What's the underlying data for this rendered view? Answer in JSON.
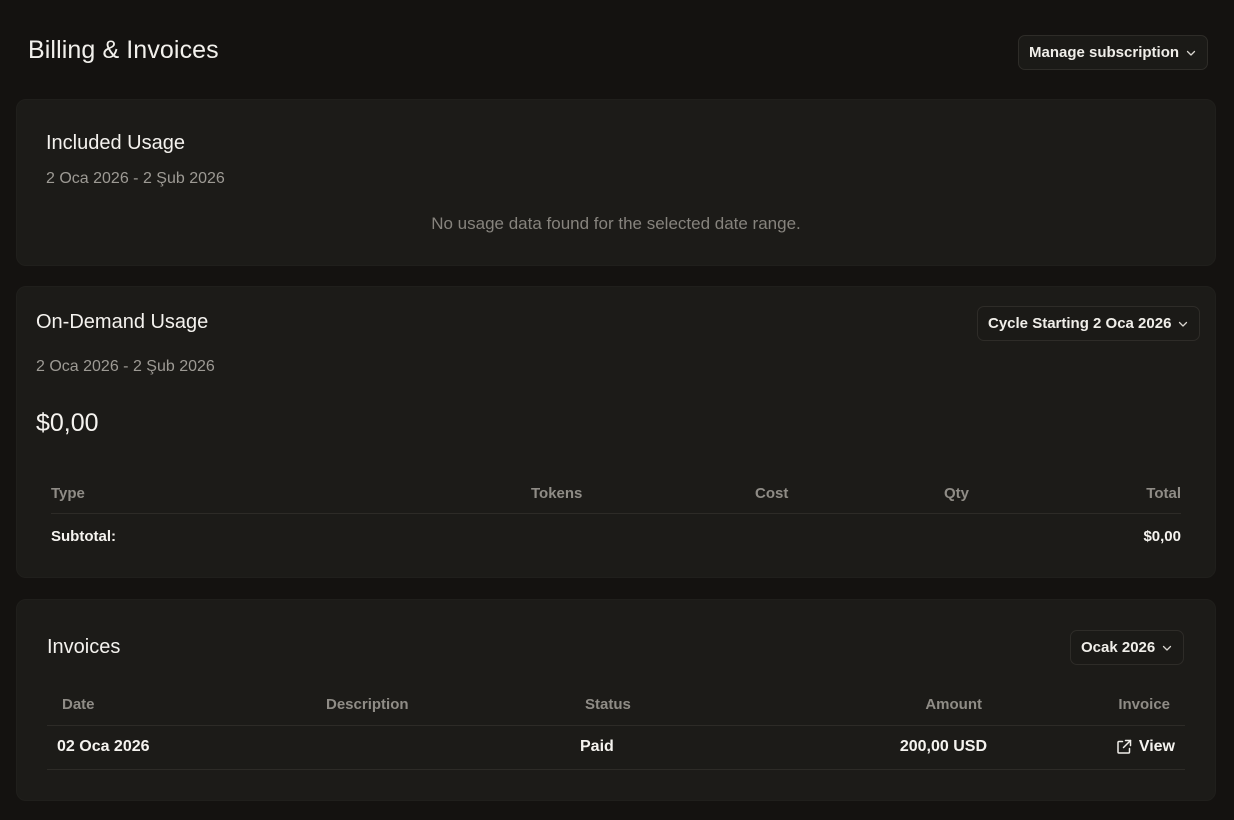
{
  "header": {
    "title": "Billing & Invoices",
    "manage_label": "Manage subscription"
  },
  "included_usage": {
    "title": "Included Usage",
    "date_range": "2 Oca 2026 - 2 Şub 2026",
    "empty_message": "No usage data found for the selected date range."
  },
  "on_demand": {
    "title": "On-Demand Usage",
    "cycle_label": "Cycle Starting 2 Oca 2026",
    "date_range": "2 Oca 2026 - 2 Şub 2026",
    "amount": "$0,00",
    "table": {
      "headers": [
        "Type",
        "Tokens",
        "Cost",
        "Qty",
        "Total"
      ],
      "subtotal_label": "Subtotal:",
      "subtotal_value": "$0,00"
    }
  },
  "invoices": {
    "title": "Invoices",
    "month_label": "Ocak 2026",
    "headers": [
      "Date",
      "Description",
      "Status",
      "Amount",
      "Invoice"
    ],
    "rows": [
      {
        "date": "02 Oca 2026",
        "description": "",
        "status": "Paid",
        "amount": "200,00 USD",
        "invoice_label": "View",
        "invoice_icon": "external-link-icon"
      }
    ]
  },
  "icons": {
    "dropdown": "chevron-down-icon",
    "invoice_link": "external-link-icon"
  },
  "colors": {
    "background": "#141210",
    "card": "#1c1b18",
    "border": "#2d2b27",
    "text": "#f2f0ec",
    "muted": "#8f8c86"
  }
}
